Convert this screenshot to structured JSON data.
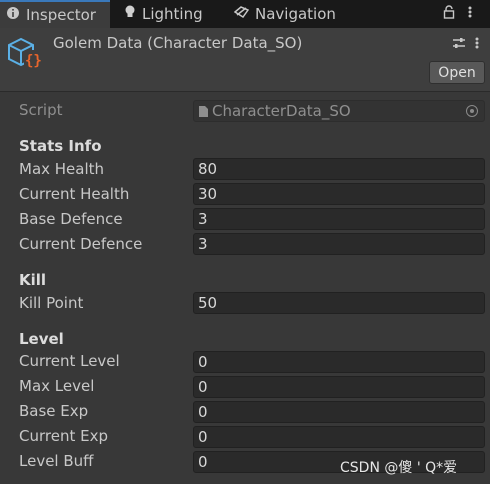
{
  "tabs": [
    {
      "label": "Inspector",
      "icon": "info-icon"
    },
    {
      "label": "Lighting",
      "icon": "bulb-icon"
    },
    {
      "label": "Navigation",
      "icon": "navigation-icon"
    }
  ],
  "header": {
    "title": "Golem Data (Character Data_SO)",
    "open_label": "Open",
    "icon": "scriptable-object-icon"
  },
  "script": {
    "label": "Script",
    "value": "CharacterData_SO"
  },
  "sections": {
    "stats": "Stats Info",
    "kill": "Kill",
    "level": "Level"
  },
  "fields": {
    "max_health": {
      "label": "Max Health",
      "value": "80"
    },
    "current_health": {
      "label": "Current Health",
      "value": "30"
    },
    "base_defence": {
      "label": "Base Defence",
      "value": "3"
    },
    "current_defence": {
      "label": "Current Defence",
      "value": "3"
    },
    "kill_point": {
      "label": "Kill Point",
      "value": "50"
    },
    "current_level": {
      "label": "Current Level",
      "value": "0"
    },
    "max_level": {
      "label": "Max Level",
      "value": "0"
    },
    "base_exp": {
      "label": "Base Exp",
      "value": "0"
    },
    "current_exp": {
      "label": "Current Exp",
      "value": "0"
    },
    "level_buff": {
      "label": "Level Buff",
      "value": "0"
    }
  },
  "watermark": "CSDN @傻 ' Q*爱",
  "colors": {
    "accent": "#3a79bb",
    "background": "#383838",
    "field": "#2a2a2a"
  }
}
